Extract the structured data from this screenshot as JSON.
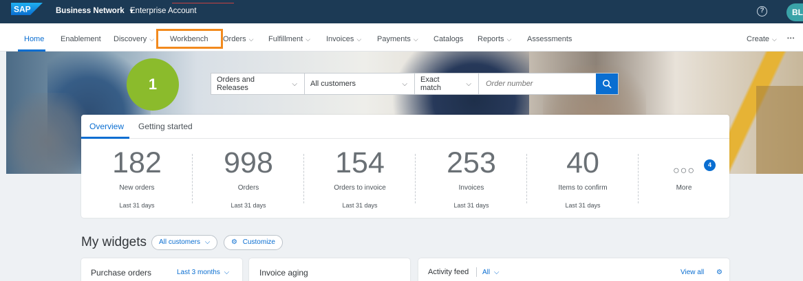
{
  "shell": {
    "logo_text": "SAP",
    "product": "Business Network",
    "account": "Enterprise Account",
    "help_symbol": "?",
    "avatar_initials": "BL"
  },
  "nav": {
    "items": [
      {
        "label": "Home",
        "has_menu": false
      },
      {
        "label": "Enablement",
        "has_menu": false
      },
      {
        "label": "Discovery",
        "has_menu": true
      },
      {
        "label": "Workbench",
        "has_menu": false
      },
      {
        "label": "Orders",
        "has_menu": true
      },
      {
        "label": "Fulfillment",
        "has_menu": true
      },
      {
        "label": "Invoices",
        "has_menu": true
      },
      {
        "label": "Payments",
        "has_menu": true
      },
      {
        "label": "Catalogs",
        "has_menu": false
      },
      {
        "label": "Reports",
        "has_menu": true
      },
      {
        "label": "Assessments",
        "has_menu": false
      }
    ],
    "create_label": "Create",
    "more_label": "•••"
  },
  "callout": {
    "step": "1"
  },
  "search": {
    "document_type": "Orders and Releases",
    "customer": "All customers",
    "match": "Exact match",
    "placeholder": "Order number"
  },
  "overview": {
    "tabs": [
      "Overview",
      "Getting started"
    ],
    "tiles": [
      {
        "value": "182",
        "label": "New orders",
        "period": "Last 31 days"
      },
      {
        "value": "998",
        "label": "Orders",
        "period": "Last 31 days"
      },
      {
        "value": "154",
        "label": "Orders to invoice",
        "period": "Last 31 days"
      },
      {
        "value": "253",
        "label": "Invoices",
        "period": "Last 31 days"
      },
      {
        "value": "40",
        "label": "Items to confirm",
        "period": "Last 31 days"
      }
    ],
    "more": {
      "dots": "○○○",
      "count": "4",
      "label": "More"
    }
  },
  "widgets": {
    "title": "My widgets",
    "customers_filter": "All customers",
    "customize_label": "Customize",
    "cards": {
      "purchase_orders": {
        "title": "Purchase orders",
        "filter": "Last 3 months"
      },
      "invoice_aging": {
        "title": "Invoice aging"
      },
      "activity_feed": {
        "title": "Activity feed",
        "filter": "All",
        "view_all": "View all"
      }
    }
  },
  "colors": {
    "shell": "#1c3a55",
    "accent": "#0a6ed1",
    "highlight": "#f28a1e",
    "callout": "#8bbb2c"
  }
}
